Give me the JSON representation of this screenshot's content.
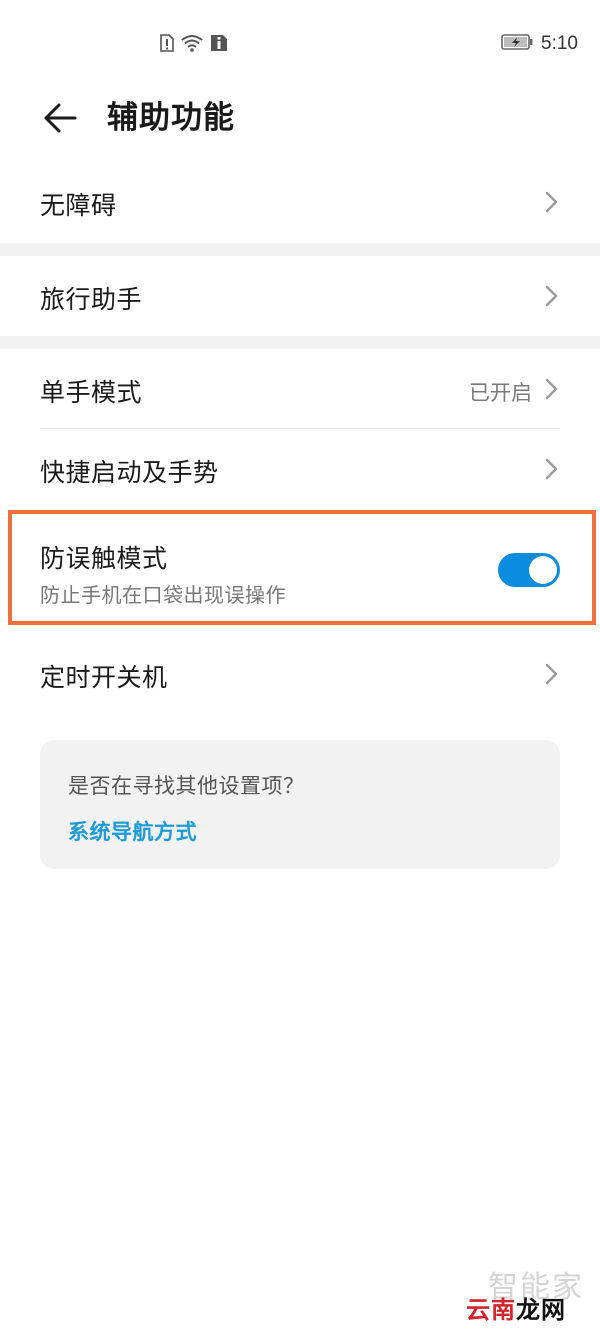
{
  "status_bar": {
    "time": "5:10",
    "icons": [
      "sim-alert-icon",
      "wifi-icon",
      "info-icon",
      "battery-charging-icon"
    ]
  },
  "header": {
    "back_icon": "arrow-left-icon",
    "title": "辅助功能"
  },
  "settings": [
    {
      "label": "无障碍"
    },
    {
      "label": "旅行助手"
    },
    {
      "label": "单手模式",
      "value": "已开启"
    },
    {
      "label": "快捷启动及手势"
    },
    {
      "label": "防误触模式",
      "subtitle": "防止手机在口袋出现误操作",
      "toggle_on": true
    },
    {
      "label": "定时开关机"
    }
  ],
  "suggest_card": {
    "question": "是否在寻找其他设置项？",
    "link": "系统导航方式"
  },
  "colors": {
    "accent": "#0a8dde",
    "link": "#1c9bd8",
    "highlight_border": "#f26f3e",
    "section_gap": "#f2f2f2"
  },
  "watermark": {
    "top": "智能家",
    "bottom_red": "云南",
    "bottom_black": "龙网"
  }
}
